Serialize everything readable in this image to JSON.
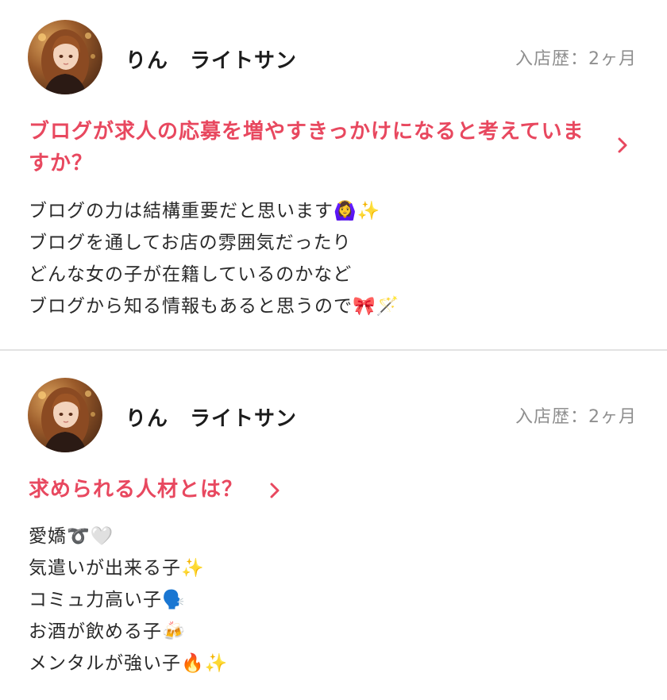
{
  "posts": [
    {
      "name": "りん　ライトサン",
      "tenure": "入店歴：2ヶ月",
      "question": "ブログが求人の応募を増やすきっかけになると考えていますか？",
      "answer_lines": [
        "ブログの力は結構重要だと思います🙆‍♀️✨",
        "ブログを通してお店の雰囲気だったり",
        "どんな女の子が在籍しているのかなど",
        "ブログから知る情報もあると思うので🎀🪄"
      ]
    },
    {
      "name": "りん　ライトサン",
      "tenure": "入店歴：2ヶ月",
      "question": "求められる人材とは？",
      "answer_lines": [
        "愛嬌➰🤍",
        "気遣いが出来る子✨",
        "コミュ力高い子🗣️",
        "お酒が飲める子🍻",
        "メンタルが強い子🔥✨"
      ]
    }
  ],
  "icons": {
    "avatar": "user-avatar-photo",
    "chevron": "chevron-right-icon"
  },
  "colors": {
    "accent": "#e8485f",
    "muted": "#8f8f8f",
    "divider": "#e2e2e2"
  }
}
